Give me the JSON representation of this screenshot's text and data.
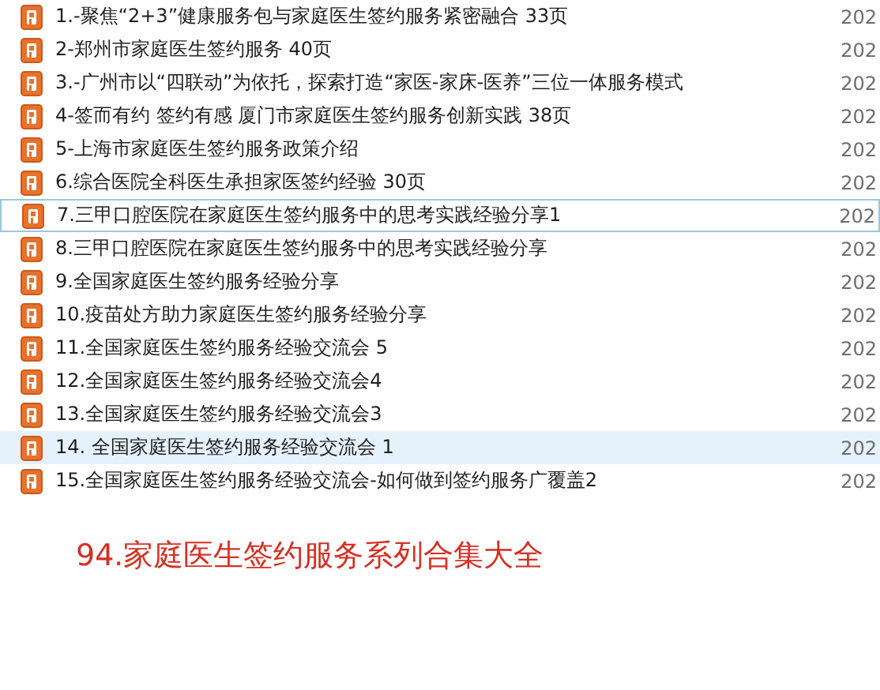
{
  "files": [
    {
      "name": "1.-聚焦“2+3”健康服务包与家庭医生签约服务紧密融合  33页",
      "date": "202",
      "focused": false,
      "highlighted": false
    },
    {
      "name": "2-郑州市家庭医生签约服务   40页",
      "date": "202",
      "focused": false,
      "highlighted": false
    },
    {
      "name": "3.-广州市以“四联动”为依托，探索打造“家医-家床-医养”三位一体服务模式",
      "date": "202",
      "focused": false,
      "highlighted": false
    },
    {
      "name": "4-签而有约 签约有感 厦门市家庭医生签约服务创新实践  38页",
      "date": "202",
      "focused": false,
      "highlighted": false
    },
    {
      "name": "5-上海市家庭医生签约服务政策介绍",
      "date": "202",
      "focused": false,
      "highlighted": false
    },
    {
      "name": "6.综合医院全科医生承担家医签约经验 30页",
      "date": "202",
      "focused": false,
      "highlighted": false
    },
    {
      "name": "7.三甲口腔医院在家庭医生签约服务中的思考实践经验分享1",
      "date": "202",
      "focused": true,
      "highlighted": false
    },
    {
      "name": "8.三甲口腔医院在家庭医生签约服务中的思考实践经验分享",
      "date": "202",
      "focused": false,
      "highlighted": false
    },
    {
      "name": "9.全国家庭医生签约服务经验分享",
      "date": "202",
      "focused": false,
      "highlighted": false
    },
    {
      "name": "10.疫苗处方助力家庭医生签约服务经验分享",
      "date": "202",
      "focused": false,
      "highlighted": false
    },
    {
      "name": "11.全国家庭医生签约服务经验交流会 5",
      "date": "202",
      "focused": false,
      "highlighted": false
    },
    {
      "name": "12.全国家庭医生签约服务经验交流会4",
      "date": "202",
      "focused": false,
      "highlighted": false
    },
    {
      "name": "13.全国家庭医生签约服务经验交流会3",
      "date": "202",
      "focused": false,
      "highlighted": false
    },
    {
      "name": "14. 全国家庭医生签约服务经验交流会 1",
      "date": "202",
      "focused": false,
      "highlighted": true
    },
    {
      "name": "15.全国家庭医生签约服务经验交流会-如何做到签约服务广覆盖2",
      "date": "202",
      "focused": false,
      "highlighted": false
    }
  ],
  "caption": "94.家庭医生签约服务系列合集大全"
}
